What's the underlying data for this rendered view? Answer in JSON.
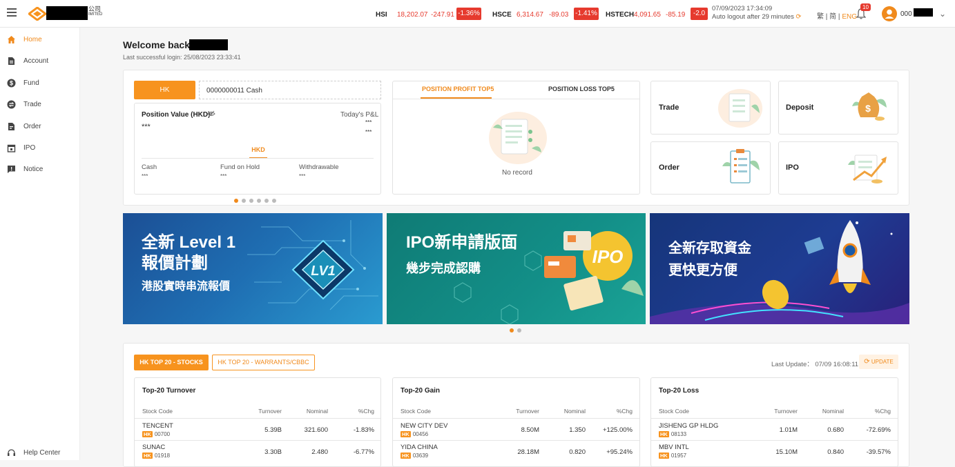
{
  "header": {
    "logo_cn": "公司",
    "logo_en": "IMITED",
    "indices": [
      {
        "name": "HSI",
        "value": "18,202.07",
        "change": "-247.91",
        "pct": "-1.36%"
      },
      {
        "name": "HSCE",
        "value": "6,314.67",
        "change": "-89.03",
        "pct": "-1.41%"
      },
      {
        "name": "HSTECH",
        "value": "4,091.65",
        "change": "-85.19",
        "pct": "-2.0"
      }
    ],
    "datetime": "07/09/2023 17:34:09",
    "logout_msg": "Auto logout after 29 minutes",
    "lang_trad": "繁",
    "lang_simp": "简",
    "lang_eng": "ENG",
    "notif_count": "10",
    "account_prefix": "000"
  },
  "sidebar": {
    "items": [
      {
        "label": "Home"
      },
      {
        "label": "Account"
      },
      {
        "label": "Fund"
      },
      {
        "label": "Trade"
      },
      {
        "label": "Order"
      },
      {
        "label": "IPO"
      },
      {
        "label": "Notice"
      }
    ],
    "help": "Help Center"
  },
  "welcome": {
    "title": "Welcome back,",
    "last_login": "Last successful login: 25/08/2023 23:33:41"
  },
  "account_card": {
    "market_tab": "HK",
    "account": "0000000011 Cash",
    "position_value_label": "Position Value (HKD)",
    "position_value": "***",
    "todays_pnl_label": "Today's P&L",
    "pnl_1": "***",
    "pnl_2": "***",
    "currency_tab": "HKD",
    "cash_label": "Cash",
    "cash": "***",
    "fund_hold_label": "Fund on Hold",
    "fund_hold": "***",
    "withdrawable_label": "Withdrawable",
    "withdrawable": "***"
  },
  "position_card": {
    "tab_profit": "POSITION PROFIT TOP5",
    "tab_loss": "POSITION LOSS TOP5",
    "empty": "No record"
  },
  "quick_links": {
    "trade": "Trade",
    "deposit": "Deposit",
    "order": "Order",
    "ipo": "IPO"
  },
  "banners": [
    {
      "line1": "全新 Level 1",
      "line2": "報價計劃",
      "line3": "港股實時串流報價",
      "art": "LV1"
    },
    {
      "line1": "IPO新申請版面",
      "line2": "幾步完成認購",
      "art": "IPO"
    },
    {
      "line1": "全新存取資金",
      "line2": "更快更方便"
    }
  ],
  "top20": {
    "tab_stocks": "HK TOP 20 - STOCKS",
    "tab_warrants": "HK TOP 20 - WARRANTS/CBBC",
    "last_update": "Last Update： 07/09 16:08:11",
    "update_btn": "UPDATE",
    "col_code": "Stock Code",
    "col_turnover": "Turnover",
    "col_nominal": "Nominal",
    "col_chg": "%Chg",
    "turnover": {
      "title": "Top-20 Turnover",
      "rows": [
        {
          "name": "TENCENT",
          "mkt": "HK",
          "code": "00700",
          "turnover": "5.39B",
          "nominal": "321.600",
          "chg": "-1.83%"
        },
        {
          "name": "SUNAC",
          "mkt": "HK",
          "code": "01918",
          "turnover": "3.30B",
          "nominal": "2.480",
          "chg": "-6.77%"
        }
      ]
    },
    "gain": {
      "title": "Top-20 Gain",
      "rows": [
        {
          "name": "NEW CITY DEV",
          "mkt": "HK",
          "code": "00456",
          "turnover": "8.50M",
          "nominal": "1.350",
          "chg": "+125.00%"
        },
        {
          "name": "YIDA CHINA",
          "mkt": "HK",
          "code": "03639",
          "turnover": "28.18M",
          "nominal": "0.820",
          "chg": "+95.24%"
        }
      ]
    },
    "loss": {
      "title": "Top-20 Loss",
      "rows": [
        {
          "name": "JISHENG GP HLDG",
          "mkt": "HK",
          "code": "08133",
          "turnover": "1.01M",
          "nominal": "0.680",
          "chg": "-72.69%"
        },
        {
          "name": "MBV INTL",
          "mkt": "HK",
          "code": "01957",
          "turnover": "15.10M",
          "nominal": "0.840",
          "chg": "-39.57%"
        }
      ]
    }
  },
  "colors": {
    "accent": "#f7931e",
    "up": "#1fa86e",
    "down": "#e63a2e"
  }
}
